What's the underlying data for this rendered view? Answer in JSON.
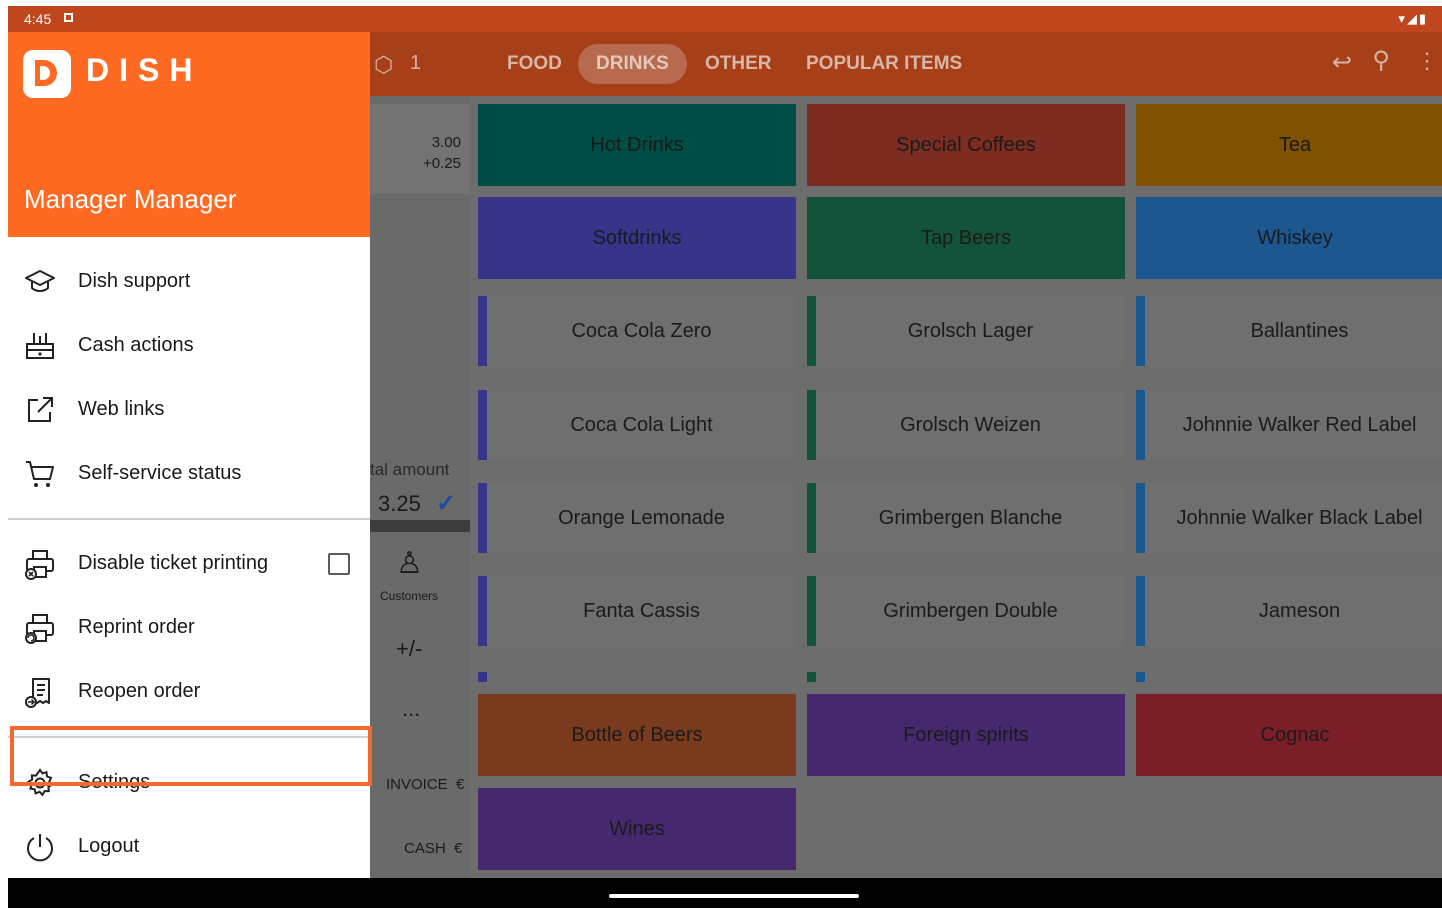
{
  "status_bar": {
    "time": "4:45"
  },
  "app_bar": {
    "ticket_count": "1",
    "tabs": [
      {
        "label": "FOOD",
        "active": false
      },
      {
        "label": "DRINKS",
        "active": true
      },
      {
        "label": "OTHER",
        "active": false
      },
      {
        "label": "POPULAR ITEMS",
        "active": false
      }
    ]
  },
  "order": {
    "price": "3.00",
    "modifier": "+0.25",
    "total_label": "tal amount",
    "total_value": "3.25",
    "customers_label": "Customers",
    "plus_minus": "+/-",
    "more": "...",
    "invoice_label": "INVOICE",
    "invoice_currency": "€",
    "cash_label": "CASH",
    "cash_currency": "€"
  },
  "categories": [
    {
      "label": "Hot Drinks",
      "color": "#004d45"
    },
    {
      "label": "Special Coffees",
      "color": "#7d2c22"
    },
    {
      "label": "Tea",
      "color": "#7f5100"
    },
    {
      "label": "Softdrinks",
      "color": "#37358a"
    },
    {
      "label": "Tap Beers",
      "color": "#13533a"
    },
    {
      "label": "Whiskey",
      "color": "#1c578f"
    }
  ],
  "items": [
    {
      "label": "Coca Cola Zero",
      "color": "#37358a"
    },
    {
      "label": "Grolsch Lager",
      "color": "#13533a"
    },
    {
      "label": "Ballantines",
      "color": "#1c578f"
    },
    {
      "label": "Coca Cola Light",
      "color": "#37358a"
    },
    {
      "label": "Grolsch Weizen",
      "color": "#13533a"
    },
    {
      "label": "Johnnie Walker Red Label",
      "color": "#1c578f"
    },
    {
      "label": "Orange Lemonade",
      "color": "#37358a"
    },
    {
      "label": "Grimbergen Blanche",
      "color": "#13533a"
    },
    {
      "label": "Johnnie Walker Black Label",
      "color": "#1c578f"
    },
    {
      "label": "Fanta Cassis",
      "color": "#37358a"
    },
    {
      "label": "Grimbergen Double",
      "color": "#13533a"
    },
    {
      "label": "Jameson",
      "color": "#1c578f"
    }
  ],
  "bottom_categories": [
    {
      "label": "Bottle of Beers",
      "color": "#7a3a1e"
    },
    {
      "label": "Foreign spirits",
      "color": "#45286e"
    },
    {
      "label": "Cognac",
      "color": "#7b1e28"
    },
    {
      "label": "Wines",
      "color": "#45286e"
    }
  ],
  "drawer": {
    "logo_text": "DISH",
    "user_name": "Manager Manager",
    "menu_group1": [
      {
        "label": "Dish support",
        "icon": "graduation-cap-icon"
      },
      {
        "label": "Cash actions",
        "icon": "cash-register-icon"
      },
      {
        "label": "Web links",
        "icon": "external-link-icon"
      },
      {
        "label": "Self-service status",
        "icon": "cart-icon"
      }
    ],
    "menu_group2": [
      {
        "label": "Disable ticket printing",
        "icon": "printer-x-icon",
        "checked": false
      },
      {
        "label": "Reprint order",
        "icon": "printer-refresh-icon"
      },
      {
        "label": "Reopen order",
        "icon": "receipt-reopen-icon"
      }
    ],
    "settings_label": "Settings",
    "logout_label": "Logout"
  }
}
